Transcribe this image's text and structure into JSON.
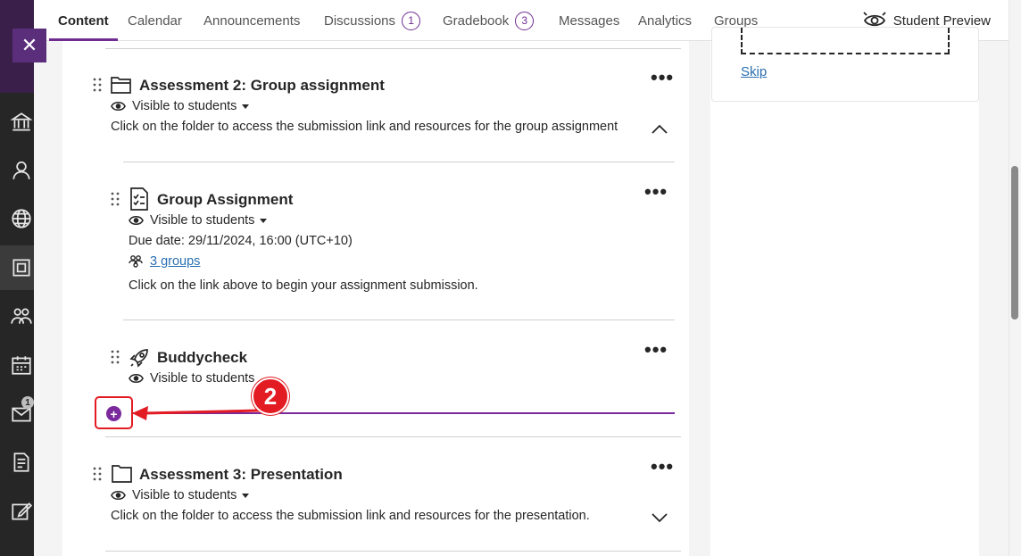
{
  "nav": {
    "tabs": [
      {
        "label": "Content"
      },
      {
        "label": "Calendar"
      },
      {
        "label": "Announcements"
      },
      {
        "label": "Discussions",
        "count": "1"
      },
      {
        "label": "Gradebook",
        "count": "3"
      },
      {
        "label": "Messages"
      },
      {
        "label": "Analytics"
      },
      {
        "label": "Groups"
      }
    ],
    "preview_label": "Student Preview"
  },
  "sidebar": {
    "close_label": "✕",
    "messages_badge": "1",
    "icons": [
      "institution-icon",
      "profile-icon",
      "globe-icon",
      "courses-icon",
      "groups-icon",
      "calendar-icon",
      "messages-icon",
      "grades-icon",
      "edit-icon"
    ]
  },
  "sidecard": {
    "skip_label": "Skip"
  },
  "items": {
    "a2": {
      "title": "Assessment 2: Group assignment",
      "visibility": "Visible to students",
      "description": "Click on the folder to access the submission link and resources for the group assignment"
    },
    "group_assignment": {
      "title": "Group Assignment",
      "visibility": "Visible to students",
      "due": "Due date: 29/11/2024, 16:00 (UTC+10)",
      "groups_link": "3 groups",
      "description": "Click on the link above to begin your assignment submission."
    },
    "buddycheck": {
      "title": "Buddycheck",
      "visibility": "Visible to students"
    },
    "a3": {
      "title": "Assessment 3: Presentation",
      "visibility": "Visible to students",
      "description": "Click on the folder to access the submission link and resources for the presentation."
    }
  },
  "more_label": "•••",
  "add_label": "+",
  "annotation": {
    "step": "2",
    "color": "#e31b23"
  },
  "colors": {
    "accent": "#6e2c90",
    "link": "#2a6fb1"
  }
}
